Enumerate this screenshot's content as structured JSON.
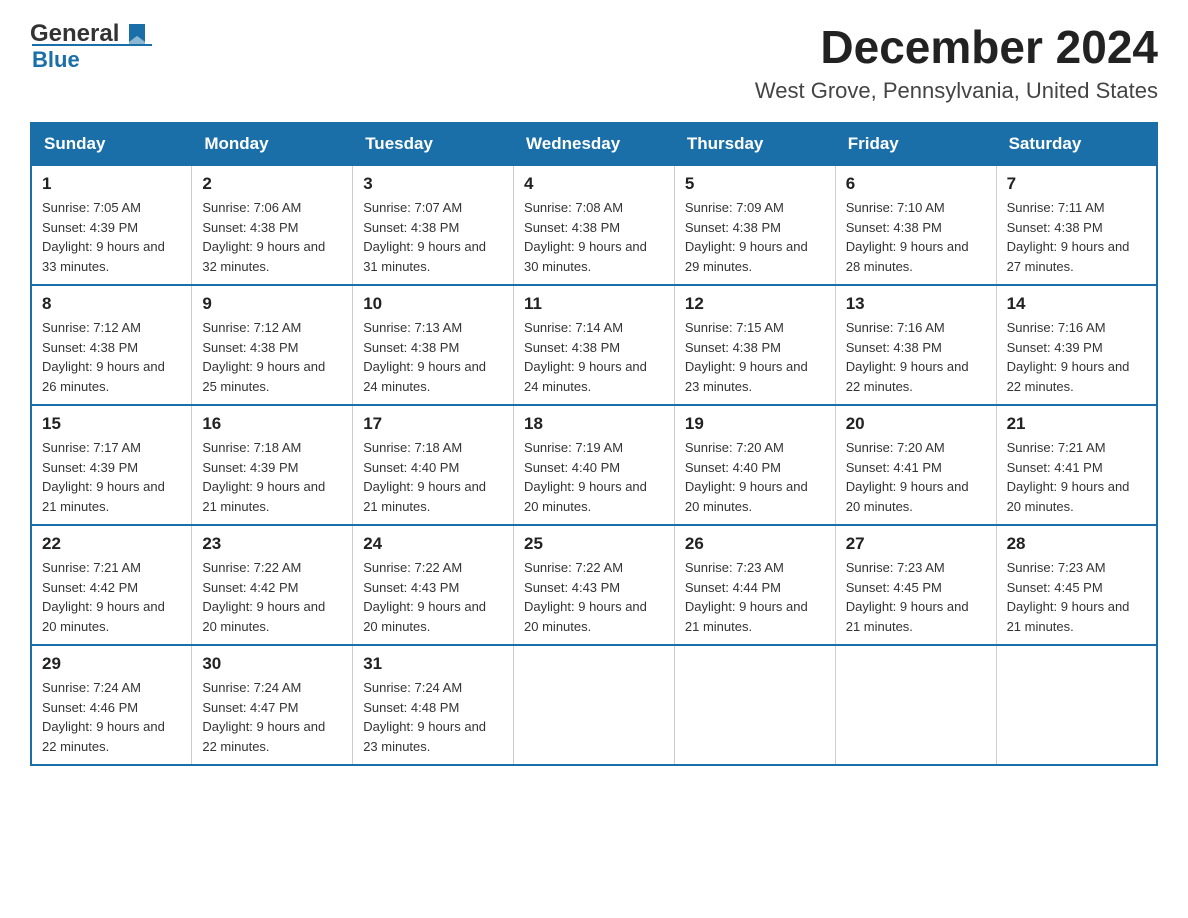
{
  "header": {
    "logo_general": "General",
    "logo_blue": "Blue",
    "title": "December 2024",
    "subtitle": "West Grove, Pennsylvania, United States"
  },
  "calendar": {
    "days_of_week": [
      "Sunday",
      "Monday",
      "Tuesday",
      "Wednesday",
      "Thursday",
      "Friday",
      "Saturday"
    ],
    "weeks": [
      [
        {
          "day": "1",
          "sunrise": "7:05 AM",
          "sunset": "4:39 PM",
          "daylight": "9 hours and 33 minutes."
        },
        {
          "day": "2",
          "sunrise": "7:06 AM",
          "sunset": "4:38 PM",
          "daylight": "9 hours and 32 minutes."
        },
        {
          "day": "3",
          "sunrise": "7:07 AM",
          "sunset": "4:38 PM",
          "daylight": "9 hours and 31 minutes."
        },
        {
          "day": "4",
          "sunrise": "7:08 AM",
          "sunset": "4:38 PM",
          "daylight": "9 hours and 30 minutes."
        },
        {
          "day": "5",
          "sunrise": "7:09 AM",
          "sunset": "4:38 PM",
          "daylight": "9 hours and 29 minutes."
        },
        {
          "day": "6",
          "sunrise": "7:10 AM",
          "sunset": "4:38 PM",
          "daylight": "9 hours and 28 minutes."
        },
        {
          "day": "7",
          "sunrise": "7:11 AM",
          "sunset": "4:38 PM",
          "daylight": "9 hours and 27 minutes."
        }
      ],
      [
        {
          "day": "8",
          "sunrise": "7:12 AM",
          "sunset": "4:38 PM",
          "daylight": "9 hours and 26 minutes."
        },
        {
          "day": "9",
          "sunrise": "7:12 AM",
          "sunset": "4:38 PM",
          "daylight": "9 hours and 25 minutes."
        },
        {
          "day": "10",
          "sunrise": "7:13 AM",
          "sunset": "4:38 PM",
          "daylight": "9 hours and 24 minutes."
        },
        {
          "day": "11",
          "sunrise": "7:14 AM",
          "sunset": "4:38 PM",
          "daylight": "9 hours and 24 minutes."
        },
        {
          "day": "12",
          "sunrise": "7:15 AM",
          "sunset": "4:38 PM",
          "daylight": "9 hours and 23 minutes."
        },
        {
          "day": "13",
          "sunrise": "7:16 AM",
          "sunset": "4:38 PM",
          "daylight": "9 hours and 22 minutes."
        },
        {
          "day": "14",
          "sunrise": "7:16 AM",
          "sunset": "4:39 PM",
          "daylight": "9 hours and 22 minutes."
        }
      ],
      [
        {
          "day": "15",
          "sunrise": "7:17 AM",
          "sunset": "4:39 PM",
          "daylight": "9 hours and 21 minutes."
        },
        {
          "day": "16",
          "sunrise": "7:18 AM",
          "sunset": "4:39 PM",
          "daylight": "9 hours and 21 minutes."
        },
        {
          "day": "17",
          "sunrise": "7:18 AM",
          "sunset": "4:40 PM",
          "daylight": "9 hours and 21 minutes."
        },
        {
          "day": "18",
          "sunrise": "7:19 AM",
          "sunset": "4:40 PM",
          "daylight": "9 hours and 20 minutes."
        },
        {
          "day": "19",
          "sunrise": "7:20 AM",
          "sunset": "4:40 PM",
          "daylight": "9 hours and 20 minutes."
        },
        {
          "day": "20",
          "sunrise": "7:20 AM",
          "sunset": "4:41 PM",
          "daylight": "9 hours and 20 minutes."
        },
        {
          "day": "21",
          "sunrise": "7:21 AM",
          "sunset": "4:41 PM",
          "daylight": "9 hours and 20 minutes."
        }
      ],
      [
        {
          "day": "22",
          "sunrise": "7:21 AM",
          "sunset": "4:42 PM",
          "daylight": "9 hours and 20 minutes."
        },
        {
          "day": "23",
          "sunrise": "7:22 AM",
          "sunset": "4:42 PM",
          "daylight": "9 hours and 20 minutes."
        },
        {
          "day": "24",
          "sunrise": "7:22 AM",
          "sunset": "4:43 PM",
          "daylight": "9 hours and 20 minutes."
        },
        {
          "day": "25",
          "sunrise": "7:22 AM",
          "sunset": "4:43 PM",
          "daylight": "9 hours and 20 minutes."
        },
        {
          "day": "26",
          "sunrise": "7:23 AM",
          "sunset": "4:44 PM",
          "daylight": "9 hours and 21 minutes."
        },
        {
          "day": "27",
          "sunrise": "7:23 AM",
          "sunset": "4:45 PM",
          "daylight": "9 hours and 21 minutes."
        },
        {
          "day": "28",
          "sunrise": "7:23 AM",
          "sunset": "4:45 PM",
          "daylight": "9 hours and 21 minutes."
        }
      ],
      [
        {
          "day": "29",
          "sunrise": "7:24 AM",
          "sunset": "4:46 PM",
          "daylight": "9 hours and 22 minutes."
        },
        {
          "day": "30",
          "sunrise": "7:24 AM",
          "sunset": "4:47 PM",
          "daylight": "9 hours and 22 minutes."
        },
        {
          "day": "31",
          "sunrise": "7:24 AM",
          "sunset": "4:48 PM",
          "daylight": "9 hours and 23 minutes."
        },
        null,
        null,
        null,
        null
      ]
    ]
  }
}
